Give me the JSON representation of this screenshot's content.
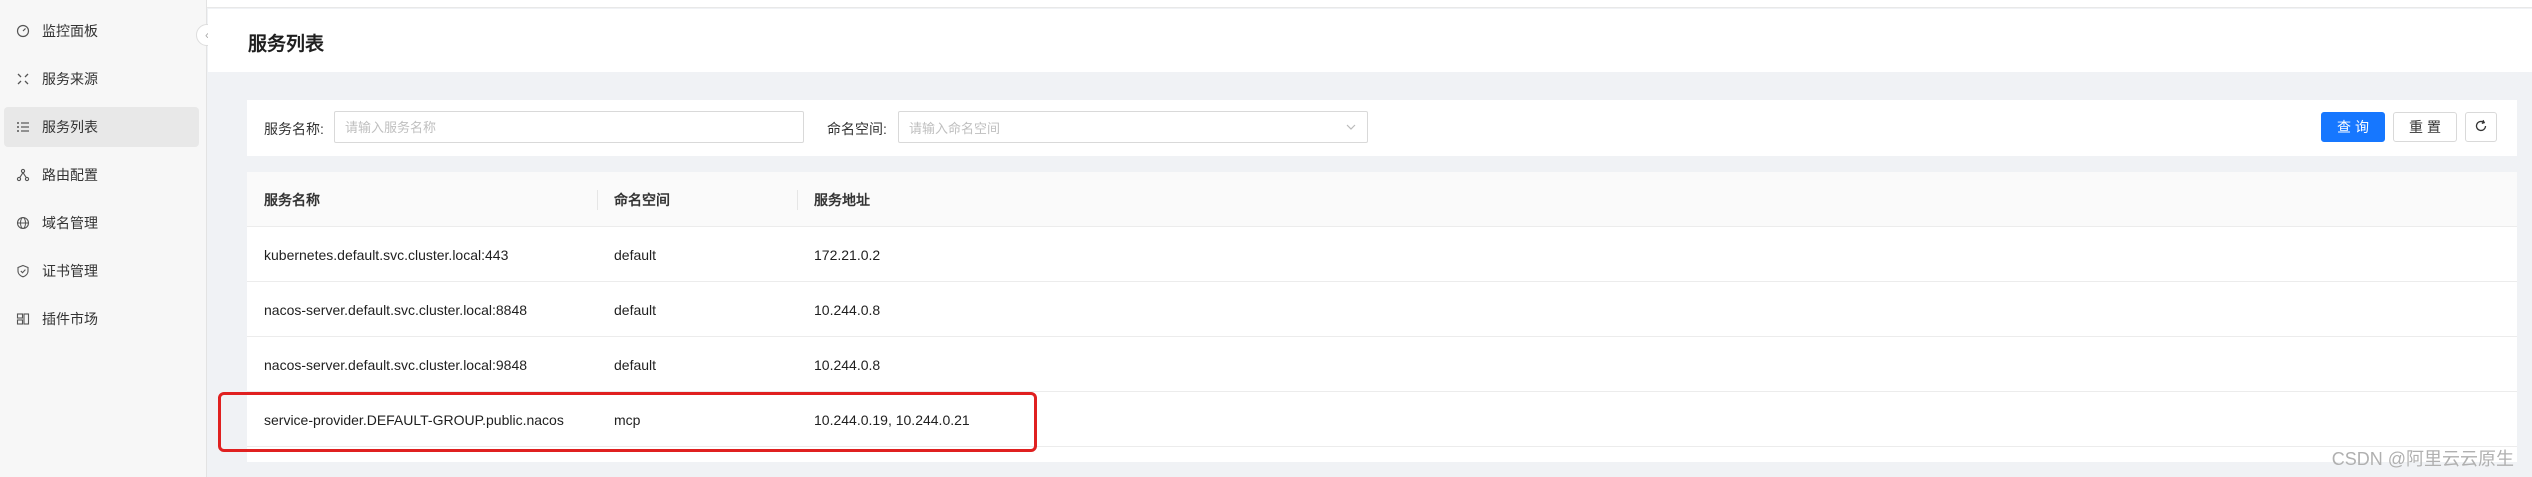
{
  "sidebar": {
    "items": [
      {
        "label": "监控面板",
        "icon": "dashboard-icon",
        "active": false
      },
      {
        "label": "服务来源",
        "icon": "source-icon",
        "active": false
      },
      {
        "label": "服务列表",
        "icon": "list-icon",
        "active": true
      },
      {
        "label": "路由配置",
        "icon": "route-icon",
        "active": false
      },
      {
        "label": "域名管理",
        "icon": "globe-icon",
        "active": false
      },
      {
        "label": "证书管理",
        "icon": "shield-icon",
        "active": false
      },
      {
        "label": "插件市场",
        "icon": "plugin-icon",
        "active": false
      }
    ],
    "collapse_icon": "chevron-left-icon"
  },
  "header": {
    "title": "服务列表"
  },
  "filters": {
    "service_name_label": "服务名称:",
    "service_name_placeholder": "请输入服务名称",
    "service_name_value": "",
    "namespace_label": "命名空间:",
    "namespace_placeholder": "请输入命名空间",
    "query_label": "查询",
    "reset_label": "重置",
    "refresh_icon": "refresh-icon"
  },
  "table": {
    "columns": [
      "服务名称",
      "命名空间",
      "服务地址"
    ],
    "rows": [
      {
        "name": "kubernetes.default.svc.cluster.local:443",
        "namespace": "default",
        "address": "172.21.0.2"
      },
      {
        "name": "nacos-server.default.svc.cluster.local:8848",
        "namespace": "default",
        "address": "10.244.0.8"
      },
      {
        "name": "nacos-server.default.svc.cluster.local:9848",
        "namespace": "default",
        "address": "10.244.0.8"
      },
      {
        "name": "service-provider.DEFAULT-GROUP.public.nacos",
        "namespace": "mcp",
        "address": "10.244.0.19, 10.244.0.21"
      }
    ]
  },
  "annotation": {
    "highlight_color": "#e02020"
  },
  "watermark": "CSDN @阿里云云原生",
  "colors": {
    "primary": "#1677ff"
  }
}
